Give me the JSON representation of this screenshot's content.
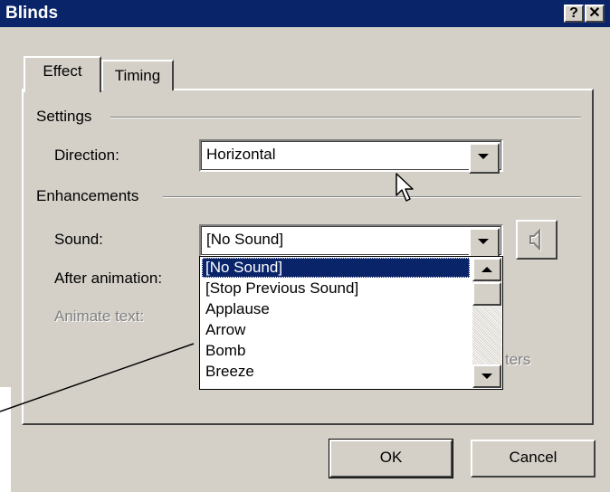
{
  "window": {
    "title": "Blinds",
    "help_button": "?",
    "close_button": "✕"
  },
  "tabs": [
    {
      "label": "Effect",
      "active": true
    },
    {
      "label": "Timing",
      "active": false
    }
  ],
  "settings": {
    "group_label": "Settings",
    "direction_label": "Direction:",
    "direction_value": "Horizontal"
  },
  "enhancements": {
    "group_label": "Enhancements",
    "sound_label": "Sound:",
    "sound_value": "[No Sound]",
    "after_animation_label": "After animation:",
    "animate_text_label": "Animate text:",
    "partial_text": "ters"
  },
  "sound_list": {
    "items": [
      "[No Sound]",
      "[Stop Previous Sound]",
      "Applause",
      "Arrow",
      "Bomb",
      "Breeze"
    ],
    "selected": "[No Sound]"
  },
  "buttons": {
    "ok": "OK",
    "cancel": "Cancel"
  },
  "icons": {
    "speaker": "speaker-icon",
    "dropdown": "chevron-down-icon",
    "cursor": "mouse-pointer-icon",
    "scroll_up": "scroll-up-icon",
    "scroll_down": "scroll-down-icon"
  },
  "colors": {
    "titlebar": "#0a246a",
    "face": "#d4d0c8",
    "selection": "#0a246a"
  }
}
